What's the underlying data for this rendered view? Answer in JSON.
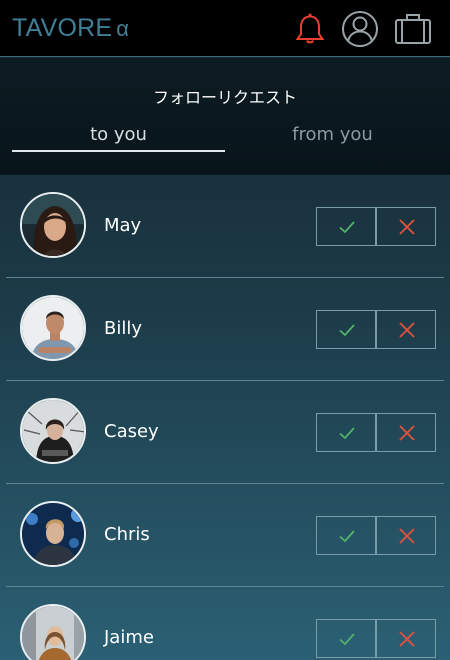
{
  "app": {
    "brand": "TAVORE",
    "brand_suffix": "α"
  },
  "topbar": {
    "icons": [
      "bell-icon",
      "user-icon",
      "briefcase-icon"
    ],
    "bell_color": "#e8402f",
    "icon_color": "#9aa3a7"
  },
  "page": {
    "title": "フォローリクエスト"
  },
  "tabs": {
    "to_you": "to you",
    "from_you": "from you",
    "active": "to you"
  },
  "requests": [
    {
      "name": "May"
    },
    {
      "name": "Billy"
    },
    {
      "name": "Casey"
    },
    {
      "name": "Chris"
    },
    {
      "name": "Jaime"
    }
  ],
  "actions": {
    "accept_icon": "check-icon",
    "reject_icon": "x-icon",
    "accept_color": "#52b26a",
    "reject_color": "#e1533f"
  }
}
